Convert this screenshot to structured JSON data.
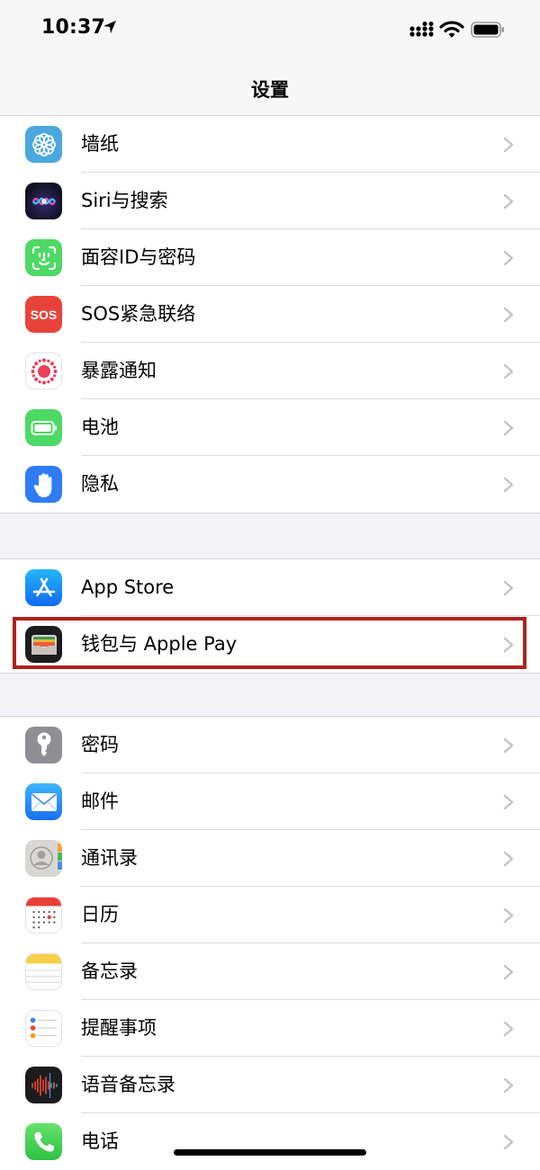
{
  "status_bar": {
    "time": "10:37"
  },
  "nav": {
    "title": "设置"
  },
  "groups": [
    {
      "items": [
        {
          "label": "墙纸",
          "icon": "wallpaper-icon",
          "color": "#4aa8de"
        },
        {
          "label": "Siri与搜索",
          "icon": "siri-icon",
          "color": "#1b1b3a"
        },
        {
          "label": "面容ID与密码",
          "icon": "face-id-icon",
          "color": "#4cd964"
        },
        {
          "label": "SOS紧急联络",
          "icon": "sos-icon",
          "color": "#e8433a",
          "icon_text": "SOS"
        },
        {
          "label": "暴露通知",
          "icon": "exposure-notification-icon",
          "color": "#ffffff"
        },
        {
          "label": "电池",
          "icon": "battery-icon",
          "color": "#4cd964"
        },
        {
          "label": "隐私",
          "icon": "privacy-hand-icon",
          "color": "#2f7cf6"
        }
      ]
    },
    {
      "items": [
        {
          "label": "App Store",
          "icon": "app-store-icon",
          "color": "#1c8ef9"
        },
        {
          "label": "钱包与 Apple Pay",
          "icon": "wallet-icon",
          "color": "#1c1c1e"
        }
      ]
    },
    {
      "items": [
        {
          "label": "密码",
          "icon": "key-icon",
          "color": "#8e8e93"
        },
        {
          "label": "邮件",
          "icon": "mail-icon",
          "color": "#2f8cf6"
        },
        {
          "label": "通讯录",
          "icon": "contacts-icon",
          "color": "#d7d5d2"
        },
        {
          "label": "日历",
          "icon": "calendar-icon",
          "color": "#ffffff"
        },
        {
          "label": "备忘录",
          "icon": "notes-icon",
          "color": "#ffffff"
        },
        {
          "label": "提醒事项",
          "icon": "reminders-icon",
          "color": "#ffffff"
        },
        {
          "label": "语音备忘录",
          "icon": "voice-memos-icon",
          "color": "#1c1c1e"
        },
        {
          "label": "电话",
          "icon": "phone-icon",
          "color": "#4cd964"
        }
      ]
    }
  ],
  "highlight_color": "#b0221d"
}
